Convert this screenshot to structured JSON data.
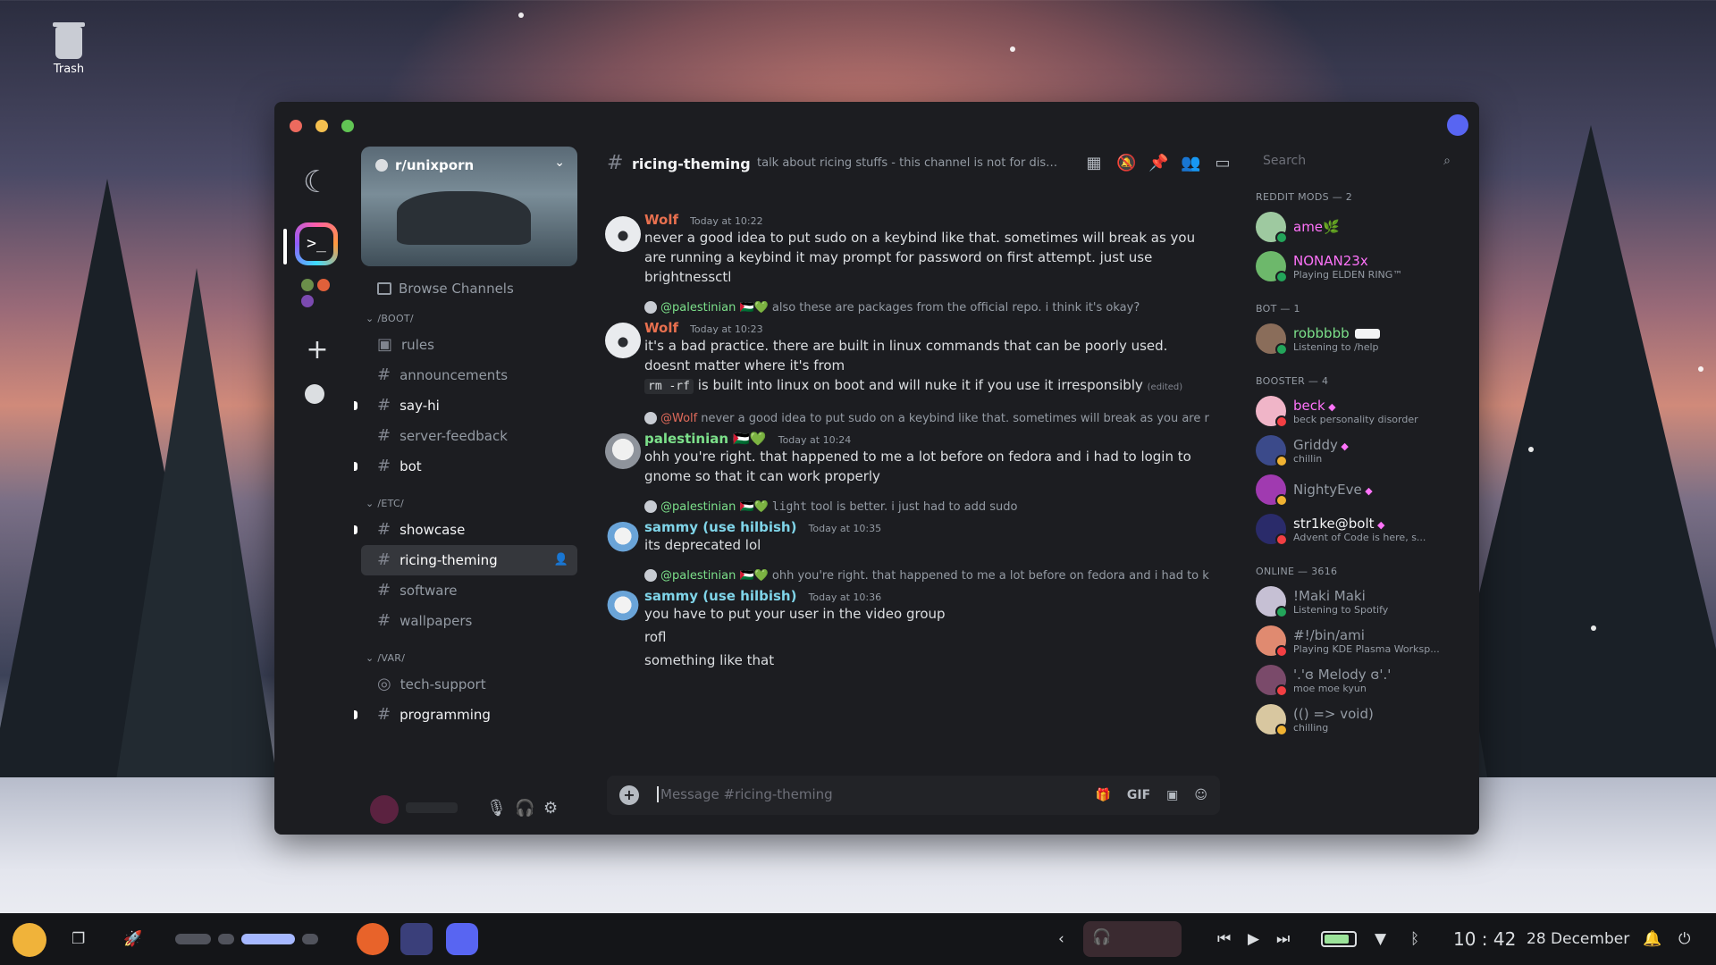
{
  "desktop": {
    "trash_label": "Trash"
  },
  "window": {
    "server_name": "r/unixporn",
    "browse_label": "Browse Channels",
    "categories": [
      {
        "name": "/BOOT/",
        "channels": [
          {
            "name": "rules",
            "icon": "rules-icon"
          },
          {
            "name": "announcements"
          },
          {
            "name": "say-hi",
            "unread": true
          },
          {
            "name": "server-feedback"
          },
          {
            "name": "bot",
            "unread": true
          }
        ]
      },
      {
        "name": "/ETC/",
        "channels": [
          {
            "name": "showcase",
            "unread": true
          },
          {
            "name": "ricing-theming",
            "active": true
          },
          {
            "name": "software"
          },
          {
            "name": "wallpapers"
          }
        ]
      },
      {
        "name": "/VAR/",
        "channels": [
          {
            "name": "tech-support",
            "icon": "forum-icon"
          },
          {
            "name": "programming",
            "unread": true
          }
        ]
      }
    ],
    "channel": {
      "name": "ricing-theming",
      "topic": "talk about ricing stuffs - this channel is not for distro...",
      "composer_placeholder": "Message #ricing-theming",
      "gif_label": "GIF"
    },
    "messages": [
      {
        "author": "Wolf",
        "author_color": "#e8704f",
        "time": "Today at 10:22",
        "avatar": "wolf",
        "lines": [
          "never a good idea to put sudo on a keybind like that. sometimes will break as you",
          "are running a keybind it may prompt for password on first attempt. just use",
          "brightnessctl"
        ]
      },
      {
        "reply_to": "@palestinian 🇵🇸💚",
        "reply_text": "also these are packages from the official repo. i think it's okay?",
        "author": "Wolf",
        "author_color": "#e8704f",
        "time": "Today at 10:23",
        "avatar": "wolf",
        "lines": [
          "it's a bad practice. there are built in linux commands that can be poorly used.",
          "doesnt matter where it's from"
        ],
        "code": "rm -rf",
        "code_suffix": " is built into linux on boot and will nuke it if you use it irresponsibly",
        "edited": "(edited)"
      },
      {
        "reply_to": "@Wolf",
        "reply_color": "red",
        "reply_text": "never a good idea to put sudo on a keybind like that. sometimes will break as you are r",
        "author": "palestinian 🇵🇸💚",
        "author_color": "#7ce08a",
        "time": "Today at 10:24",
        "avatar": "pal",
        "lines": [
          "ohh you're right. that happened to me a lot before on fedora and i had to login to",
          "gnome so that it can work properly"
        ]
      },
      {
        "reply_to": "@palestinian 🇵🇸💚",
        "reply_code": "light",
        "reply_text": "tool is better. i just had to add sudo",
        "author": "sammy (use hilbish)",
        "author_color": "#7fd4e8",
        "time": "Today at 10:35",
        "avatar": "sam",
        "lines": [
          "its deprecated lol"
        ]
      },
      {
        "reply_to": "@palestinian 🇵🇸💚",
        "reply_text": "ohh you're right. that happened to me a lot before on fedora and i had to k",
        "author": "sammy (use hilbish)",
        "author_color": "#7fd4e8",
        "time": "Today at 10:36",
        "avatar": "sam",
        "lines": [
          "you have to put your user in the video group",
          "rofl",
          "something like that"
        ]
      }
    ],
    "members": {
      "search_placeholder": "Search",
      "groups": [
        {
          "title": "REDDIT MODS — 2",
          "items": [
            {
              "name": "ame🌿",
              "color": "#ff73fa",
              "status": "",
              "avatar": "#9ec9a0",
              "dot": "#23a55a"
            },
            {
              "name": "NONAN23x",
              "color": "#ff73fa",
              "status": "Playing ELDEN RING™",
              "avatar": "#6db86b",
              "dot": "#23a55a"
            }
          ]
        },
        {
          "title": "BOT — 1",
          "items": [
            {
              "name": "robbbbb",
              "color": "#7ce08a",
              "status": "Listening to /help",
              "avatar": "#8a6d5a",
              "dot": "#23a55a",
              "bot": "BOT"
            }
          ]
        },
        {
          "title": "BOOSTER — 4",
          "items": [
            {
              "name": "beck",
              "color": "#ff73fa",
              "status": "beck personality disorder",
              "avatar": "#f0b5c8",
              "dot": "#f23f43",
              "gem": true
            },
            {
              "name": "Griddy",
              "color": "#949ba4",
              "status": "chillin",
              "avatar": "#3b4a8a",
              "dot": "#f0b232",
              "gem": true
            },
            {
              "name": "NightyEve",
              "color": "#949ba4",
              "status": "",
              "avatar": "#a03ab0",
              "dot": "#f0b232",
              "gem": true
            },
            {
              "name": "str1ke@bolt",
              "color": "#f2f3f5",
              "status": "Advent of Code is here, s...",
              "avatar": "#2a2b6a",
              "dot": "#f23f43",
              "gem": true
            }
          ]
        },
        {
          "title": "ONLINE — 3616",
          "items": [
            {
              "name": "!Maki Maki",
              "color": "#949ba4",
              "status": "Listening to Spotify",
              "avatar": "#c6c0d4",
              "dot": "#23a55a"
            },
            {
              "name": "#!/bin/ami",
              "color": "#949ba4",
              "status": "Playing KDE Plasma Worksp...",
              "avatar": "#e08a70",
              "dot": "#f23f43"
            },
            {
              "name": "'.'ɞ Melody ɞ'.'",
              "color": "#949ba4",
              "status": "moe moe kyun",
              "avatar": "#7a4a6a",
              "dot": "#f23f43"
            },
            {
              "name": "(() => void)",
              "color": "#949ba4",
              "status": "chilling",
              "avatar": "#d8c7a0",
              "dot": "#f0b232"
            }
          ]
        }
      ]
    }
  },
  "taskbar": {
    "time": "10 : 42",
    "date": "28 December",
    "battery_level": 0.85,
    "colors": {
      "accent": "#a6b8ff",
      "battery": "#9be39a"
    }
  }
}
